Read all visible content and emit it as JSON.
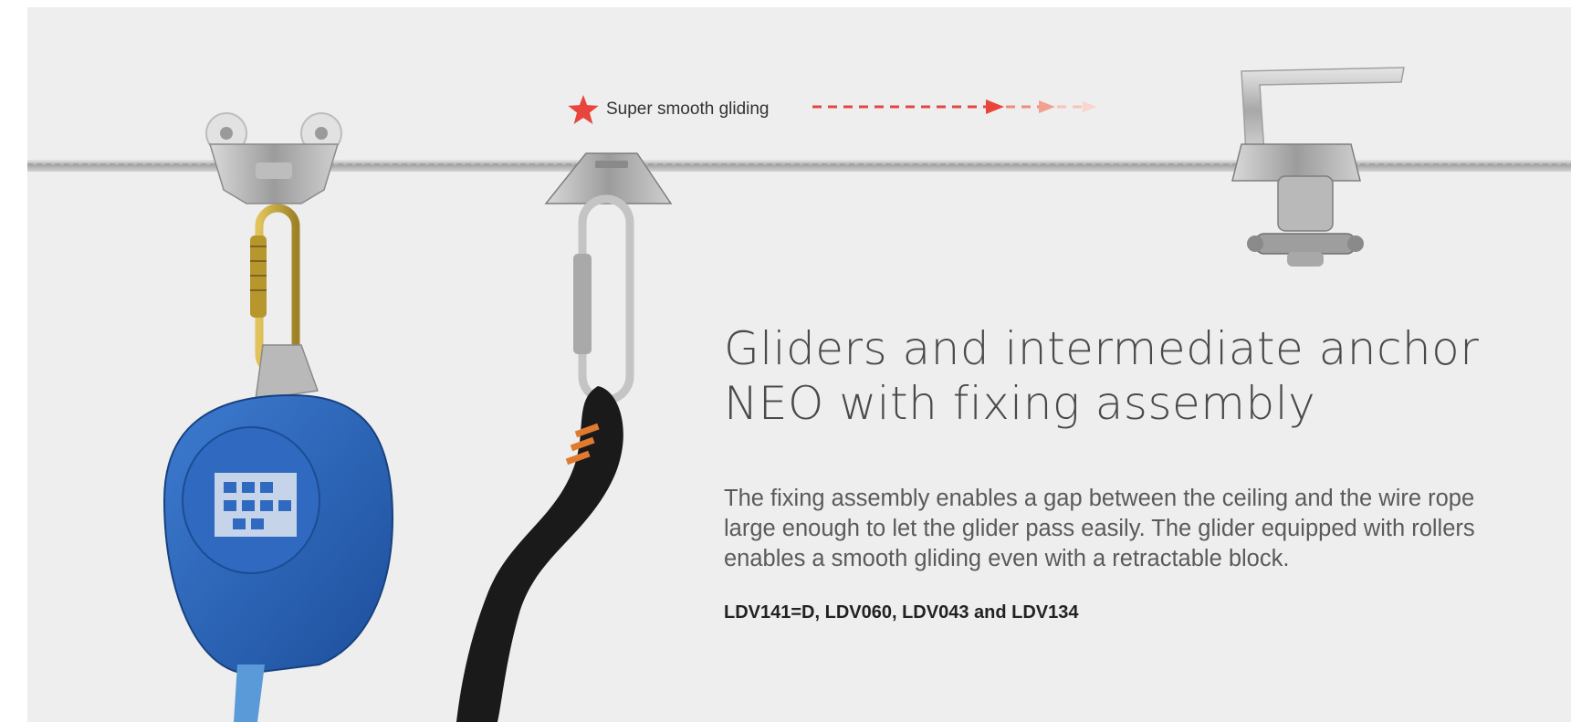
{
  "callout": {
    "label": "Super smooth gliding",
    "icon": "star-icon",
    "accent_color": "#e8453c"
  },
  "heading": {
    "line1": "Gliders and intermediate anchor",
    "line2": "NEO with fixing assembly"
  },
  "description": "The fixing assembly enables a gap between the ceiling and the wire rope large enough to let the glider pass easily. The glider equipped with rollers enables a smooth gliding even with a retractable block.",
  "product_codes": "LDV141=D, LDV060, LDV043 and LDV134",
  "colors": {
    "background": "#eeeeee",
    "retractable_block": "#2a63b8",
    "lanyard": "#1a1a1a",
    "lanyard_stitch": "#e07a2e",
    "carabiner_gold": "#c9a93c"
  }
}
